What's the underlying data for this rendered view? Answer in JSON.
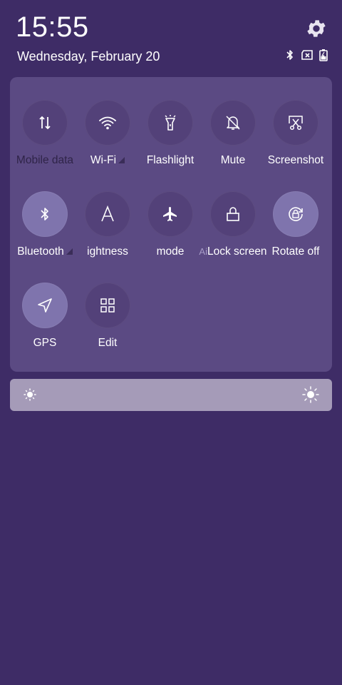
{
  "status": {
    "time": "15:55",
    "date": "Wednesday, February 20"
  },
  "icons": {
    "settings": "gear-icon",
    "bluetooth_status": "bluetooth-icon",
    "no_sim": "no-sim-icon",
    "battery": "battery-charging-icon"
  },
  "tiles": [
    {
      "label": "Mobile data",
      "icon": "mobile-data-icon",
      "active": false
    },
    {
      "label": "Wi-Fi",
      "icon": "wifi-icon",
      "active": false
    },
    {
      "label": "Flashlight",
      "icon": "flashlight-icon",
      "active": false
    },
    {
      "label": "Mute",
      "icon": "mute-bell-icon",
      "active": false
    },
    {
      "label": "Screenshot",
      "icon": "screenshot-icon",
      "active": false
    },
    {
      "label": "Bluetooth",
      "icon": "bluetooth-icon",
      "active": true
    },
    {
      "label": "ightness",
      "icon": "auto-brightness-icon",
      "active": false
    },
    {
      "label": "mode",
      "icon": "airplane-icon",
      "active": false
    },
    {
      "label": "Lock screen",
      "label_prefix": "Ai",
      "icon": "lock-icon",
      "active": false
    },
    {
      "label": "Rotate off",
      "icon": "rotate-lock-icon",
      "active": true
    },
    {
      "label": "GPS",
      "icon": "location-arrow-icon",
      "active": true
    },
    {
      "label": "Edit",
      "icon": "grid-edit-icon",
      "active": false
    }
  ],
  "brightness": {
    "low_icon": "sun-low-icon",
    "high_icon": "sun-high-icon"
  },
  "colors": {
    "background": "#3e2c66",
    "panel": "#5b4a83",
    "tile_off": "#534179",
    "tile_on": "#7f74ad",
    "brightness_bar": "#a59bb8"
  }
}
